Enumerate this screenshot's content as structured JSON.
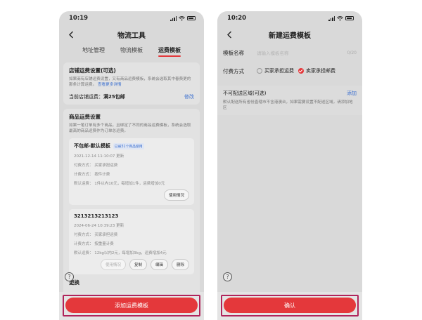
{
  "left": {
    "time": "10:19",
    "title": "物流工具",
    "tabs": [
      {
        "label": "地址管理",
        "active": false
      },
      {
        "label": "物流模板",
        "active": false
      },
      {
        "label": "运费模板",
        "active": true
      }
    ],
    "shop": {
      "title": "店铺运费设置(可选)",
      "desc": "如果商有店铺运费设置，又有商品运费模板，系统会选取其中春费更的那条计算运费。",
      "desc_link": "查看更多详情",
      "current_label": "当前店铺运费：",
      "current_value": "满25包邮",
      "edit": "修改"
    },
    "goods": {
      "title": "商品运费设置",
      "desc": "如果一笔订单有多个商品，且绑定了不同的商品运费模板，系统会选取最高的商品运费作为订单总运费。",
      "templates": [
        {
          "name": "不包邮-默认模板",
          "badge": "已被31个商品使用",
          "date": "2021-12-14 11:10:07 更新",
          "lines": [
            "付费方式：    买家承担运费",
            "计费方式：    按件计费",
            "默认运费：    1件以内10元，每增加1件，运费增加0元"
          ],
          "buttons": [
            {
              "label": "使用情况",
              "disabled": false
            }
          ]
        },
        {
          "name": "3213213213123",
          "badge": "",
          "date": "2024-06-24 10:39:23 更新",
          "lines": [
            "付费方式：    买家承担运费",
            "计费方式：    按重量计费",
            "默认运费：    12kg以内2元，每增加3kg，运费增加4元"
          ],
          "buttons": [
            {
              "label": "使用情况",
              "disabled": true
            },
            {
              "label": "复制",
              "disabled": false
            },
            {
              "label": "编辑",
              "disabled": false
            },
            {
              "label": "删除",
              "disabled": false
            }
          ]
        }
      ],
      "partial": "更换"
    },
    "help": "?",
    "primary_button": "添加运费模板"
  },
  "right": {
    "time": "10:20",
    "title": "新建运费模板",
    "name_label": "模板名称",
    "name_placeholder": "请输入模板名称",
    "counter": "0/20",
    "pay_label": "付费方式",
    "pay_options": [
      {
        "label": "买家承担运费",
        "checked": false
      },
      {
        "label": "卖家承担邮费",
        "checked": true
      }
    ],
    "area_title": "不可配送区域(可选)",
    "area_add": "添加",
    "area_desc": "默认配送所有省份直辖市不含港澳台，如果需要设置不配送区域，请添加地区",
    "help": "?",
    "primary_button": "确认"
  },
  "colors": {
    "accent": "#e4383b",
    "highlight": "#b0245b",
    "link": "#3b6fcf"
  }
}
